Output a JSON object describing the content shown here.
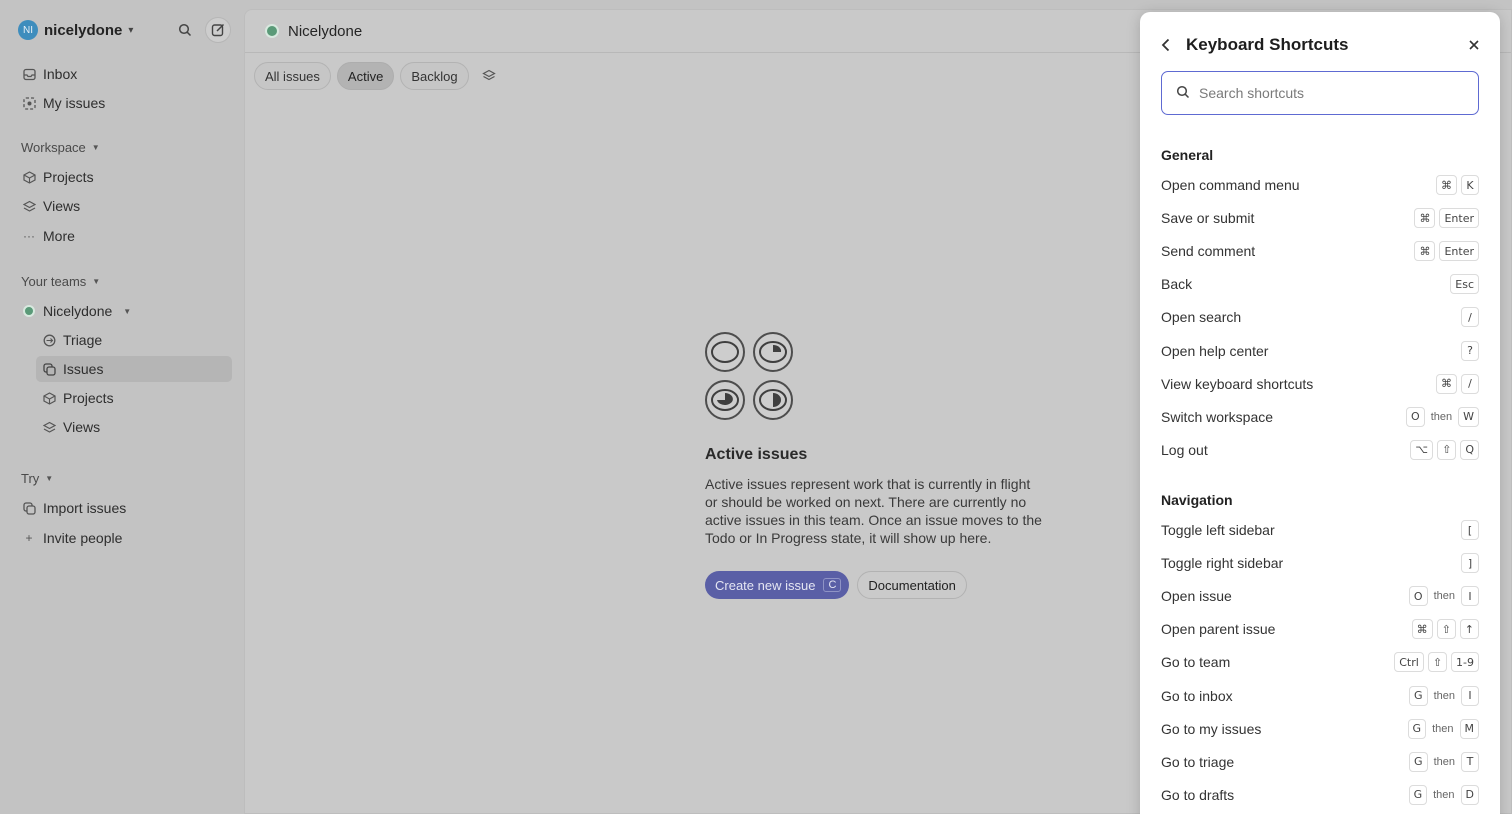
{
  "workspace": {
    "initials": "NI",
    "name": "nicelydone"
  },
  "sidebar": {
    "top_items": [
      {
        "label": "Inbox"
      },
      {
        "label": "My issues"
      }
    ],
    "workspace_label": "Workspace",
    "workspace_items": [
      {
        "label": "Projects"
      },
      {
        "label": "Views"
      },
      {
        "label": "More"
      }
    ],
    "teams_label": "Your teams",
    "team": {
      "name": "Nicelydone"
    },
    "team_items": [
      {
        "label": "Triage"
      },
      {
        "label": "Issues"
      },
      {
        "label": "Projects"
      },
      {
        "label": "Views"
      }
    ],
    "try_label": "Try",
    "try_items": [
      {
        "label": "Import issues"
      },
      {
        "label": "Invite people"
      }
    ]
  },
  "main": {
    "title": "Nicelydone",
    "filters": [
      {
        "label": "All issues"
      },
      {
        "label": "Active"
      },
      {
        "label": "Backlog"
      }
    ],
    "empty": {
      "title": "Active issues",
      "text": "Active issues represent work that is currently in flight or should be worked on next. There are currently no active issues in this team. Once an issue moves to the Todo or In Progress state, it will show up here.",
      "primary_label": "Create new issue",
      "primary_key": "C",
      "secondary_label": "Documentation"
    }
  },
  "shortcuts": {
    "title": "Keyboard Shortcuts",
    "search_placeholder": "Search shortcuts",
    "groups": [
      {
        "title": "General",
        "items": [
          {
            "label": "Open command menu",
            "keys": [
              "⌘",
              "K"
            ]
          },
          {
            "label": "Save or submit",
            "keys": [
              "⌘",
              "Enter"
            ]
          },
          {
            "label": "Send comment",
            "keys": [
              "⌘",
              "Enter"
            ]
          },
          {
            "label": "Back",
            "keys": [
              "Esc"
            ]
          },
          {
            "label": "Open search",
            "keys": [
              "/"
            ]
          },
          {
            "label": "Open help center",
            "keys": [
              "?"
            ]
          },
          {
            "label": "View keyboard shortcuts",
            "keys": [
              "⌘",
              "/"
            ]
          },
          {
            "label": "Switch workspace",
            "keys": [
              "O",
              "then",
              "W"
            ]
          },
          {
            "label": "Log out",
            "keys": [
              "⌥",
              "⇧",
              "Q"
            ]
          }
        ]
      },
      {
        "title": "Navigation",
        "items": [
          {
            "label": "Toggle left sidebar",
            "keys": [
              "["
            ]
          },
          {
            "label": "Toggle right sidebar",
            "keys": [
              "]"
            ]
          },
          {
            "label": "Open issue",
            "keys": [
              "O",
              "then",
              "I"
            ]
          },
          {
            "label": "Open parent issue",
            "keys": [
              "⌘",
              "⇧",
              "↑"
            ]
          },
          {
            "label": "Go to team",
            "keys": [
              "Ctrl",
              "⇧",
              "1-9"
            ]
          },
          {
            "label": "Go to inbox",
            "keys": [
              "G",
              "then",
              "I"
            ]
          },
          {
            "label": "Go to my issues",
            "keys": [
              "G",
              "then",
              "M"
            ]
          },
          {
            "label": "Go to triage",
            "keys": [
              "G",
              "then",
              "T"
            ]
          },
          {
            "label": "Go to drafts",
            "keys": [
              "G",
              "then",
              "D"
            ]
          }
        ]
      }
    ]
  },
  "colors": {
    "accent": "#5e6ad2",
    "primary_button": "#5a5fa6",
    "avatar": "#3e8dbd",
    "team": "#5a9a78"
  }
}
